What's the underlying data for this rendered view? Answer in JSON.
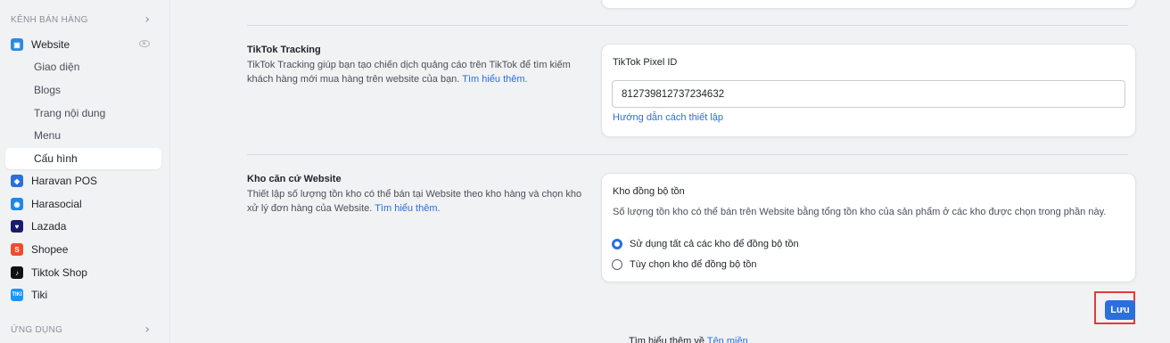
{
  "sidebar": {
    "sales_channels_title": "KÊNH BÁN HÀNG",
    "apps_title": "ỨNG DỤNG",
    "website": {
      "label": "Website"
    },
    "website_sub": [
      {
        "label": "Giao diện"
      },
      {
        "label": "Blogs"
      },
      {
        "label": "Trang nội dung"
      },
      {
        "label": "Menu"
      },
      {
        "label": "Cấu hình"
      }
    ],
    "channels": [
      {
        "label": "Haravan POS",
        "color": "#2a6fdb"
      },
      {
        "label": "Harasocial",
        "color": "#1e88e5"
      },
      {
        "label": "Lazada",
        "color": "#1a1a6e"
      },
      {
        "label": "Shopee",
        "color": "#ee4d2d"
      },
      {
        "label": "Tiktok Shop",
        "color": "#111111"
      },
      {
        "label": "Tiki",
        "color": "#1a94ff"
      }
    ]
  },
  "tiktok": {
    "title": "TikTok Tracking",
    "desc": "TikTok Tracking giúp bạn tạo chiến dịch quảng cáo trên TikTok để tìm kiếm khách hàng mới mua hàng trên website của bạn.",
    "learn_more": "Tìm hiểu thêm.",
    "pixel_label": "TikTok Pixel ID",
    "pixel_value": "812739812737234632",
    "setup_guide": "Hướng dẫn cách thiết lập"
  },
  "warehouse": {
    "title": "Kho căn cứ Website",
    "desc": "Thiết lập số lượng tồn kho có thể bán tại Website theo kho hàng và chọn kho xử lý đơn hàng của Website.",
    "learn_more": "Tìm hiểu thêm.",
    "sync_label": "Kho đồng bộ tồn",
    "sync_desc": "Số lượng tồn kho có thể bán trên Website bằng tổng tồn kho của sản phẩm ở các kho được chọn trong phần này.",
    "options": [
      {
        "label": "Sử dụng tất cả các kho để đồng bộ tồn",
        "checked": true
      },
      {
        "label": "Tùy chọn kho để đồng bộ tồn",
        "checked": false
      }
    ]
  },
  "actions": {
    "save_label": "Lưu"
  },
  "footer": {
    "prefix": "Tìm hiểu thêm về ",
    "link": "Tên miền"
  }
}
